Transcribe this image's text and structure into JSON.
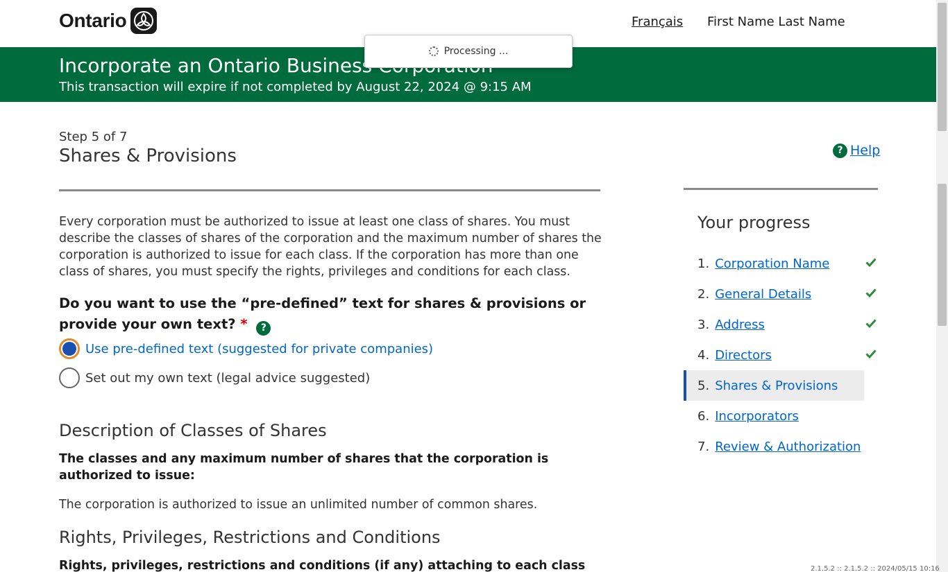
{
  "header": {
    "logo_text": "Ontario",
    "lang_link": "Français",
    "user_name": "First Name Last Name"
  },
  "banner": {
    "title": "Incorporate an Ontario Business Corporation",
    "subtitle": "This transaction will expire if not completed by August 22, 2024 @ 9:15 AM"
  },
  "processing": {
    "text": "Processing ..."
  },
  "main": {
    "step": "Step 5 of 7",
    "title": "Shares & Provisions",
    "help_label": "Help",
    "intro": "Every corporation must be authorized to issue at least one class of shares. You must describe the classes of shares of the corporation and the maximum number of shares the corporation is authorized to issue for each class. If the corporation has more than one class of shares, you must specify the rights, privileges and conditions for each class.",
    "question": "Do you want to use the “pre-defined” text for shares & provisions or provide your own text?",
    "required_mark": "*",
    "options": [
      {
        "label": "Use pre-defined text (suggested for private companies)",
        "selected": true
      },
      {
        "label": "Set out my own text (legal advice suggested)",
        "selected": false
      }
    ],
    "desc_heading": "Description of Classes of Shares",
    "desc_label": "The classes and any maximum number of shares that the corporation is authorized to issue:",
    "desc_value": "The corporation is authorized to issue an unlimited number of common shares.",
    "rights_heading": "Rights, Privileges, Restrictions and Conditions",
    "rights_label": "Rights, privileges, restrictions and conditions (if any) attaching to each class of shares and"
  },
  "progress": {
    "title": "Your progress",
    "items": [
      {
        "num": "1.",
        "label": "Corporation Name",
        "complete": true
      },
      {
        "num": "2.",
        "label": "General Details",
        "complete": true
      },
      {
        "num": "3.",
        "label": "Address",
        "complete": true
      },
      {
        "num": "4.",
        "label": "Directors",
        "complete": true
      },
      {
        "num": "5.",
        "label": "Shares & Provisions",
        "complete": false,
        "current": true
      },
      {
        "num": "6.",
        "label": "Incorporators",
        "complete": false
      },
      {
        "num": "7.",
        "label": "Review & Authorization",
        "complete": false
      }
    ]
  },
  "footer": {
    "version": "2.1.5.2 :: 2.1.5.2 :: 2024/05/15 10:16"
  },
  "colors": {
    "brand_green": "#006b3d",
    "link_blue": "#0066cc",
    "check_green": "#2e8b3d",
    "selected_blue": "#1a4fb0",
    "focus_orange": "#e08a2e"
  }
}
